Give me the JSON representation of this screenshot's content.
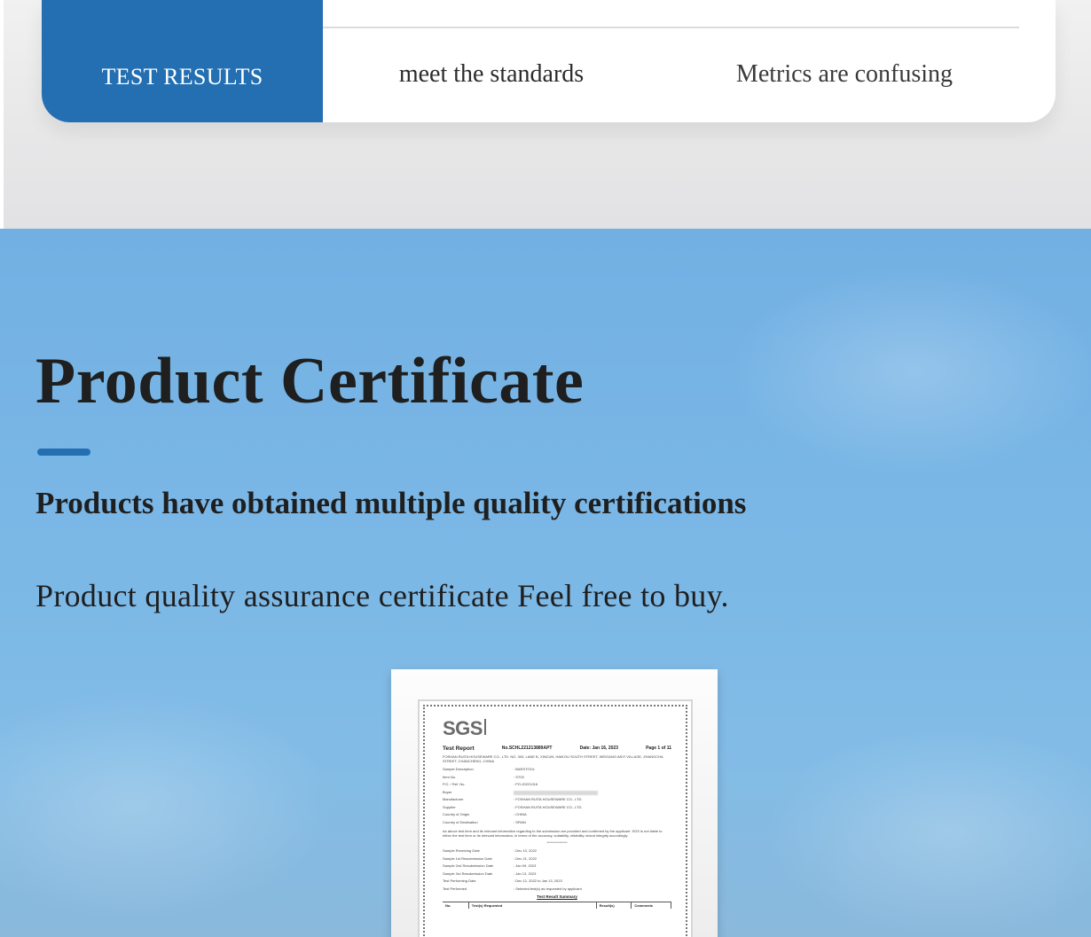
{
  "compare": {
    "active_label": "TEST RESULTS",
    "col1": "meet the standards",
    "col2": "Metrics are confusing"
  },
  "section": {
    "title": "Product Certificate",
    "subtitle": "Products have obtained multiple quality certifications",
    "description": "Product quality assurance certificate Feel free to buy."
  },
  "certificate": {
    "logo": "SGS",
    "report_label": "Test Report",
    "report_no": "No.SCHL221213889APT",
    "date": "Date: Jan 16, 2023",
    "page": "Page 1 of 11",
    "address": "FOSHAN RUITA HOUSEWARE CO., LTD. NO. 303, LANE B, XINCUN, HAIKOU SOUTH STREET, WEIGANG ANYI VILLAGE, ZHANGCHA STREET, CHANCHENG, CHINA",
    "rows": [
      {
        "k": "Sample Description",
        "v": ": BARSTOOL"
      },
      {
        "k": "Item No.",
        "v": ": ST03"
      },
      {
        "k": "P.O. / Ref. No.",
        "v": ": PO-20221016"
      },
      {
        "k": "Buyer",
        "v": ": --------"
      },
      {
        "k": "Manufacturer",
        "v": ": FOSHAN RUITA HOUSEWARE CO., LTD."
      },
      {
        "k": "Supplier",
        "v": ": FOSHAN RUITA HOUSEWARE CO., LTD."
      },
      {
        "k": "Country of Origin",
        "v": ": CHINA"
      },
      {
        "k": "Country of Destination",
        "v": ": SPAIN"
      }
    ],
    "disclaimer": "As above test item and its relevant information regarding to the submission are provided and confirmed by the applicant. SGS is not liable to either the test item or its relevant information, in terms of the accuracy, suitability, reliability or/and integrity accordingly.",
    "divider": "***************",
    "dates": [
      {
        "k": "Sample Receiving Date",
        "v": ": Dec 10, 2022"
      },
      {
        "k": "Sample 1st Resubmission Date",
        "v": ": Dec 21, 2022"
      },
      {
        "k": "Sample 2nd Resubmission Date",
        "v": ": Jan 09, 2023"
      },
      {
        "k": "Sample 3rd Resubmission Date",
        "v": ": Jan 13, 2023"
      },
      {
        "k": "Test Performing Date",
        "v": ": Dec 12, 2022 to Jan 13, 2023"
      },
      {
        "k": "Test Performed",
        "v": ": Selected test(s) as requested by applicant"
      }
    ],
    "summary_label": "Test Result Summary",
    "table_headers": [
      "No.",
      "Test(s) Requested",
      "Result(s)",
      "Comments"
    ]
  }
}
